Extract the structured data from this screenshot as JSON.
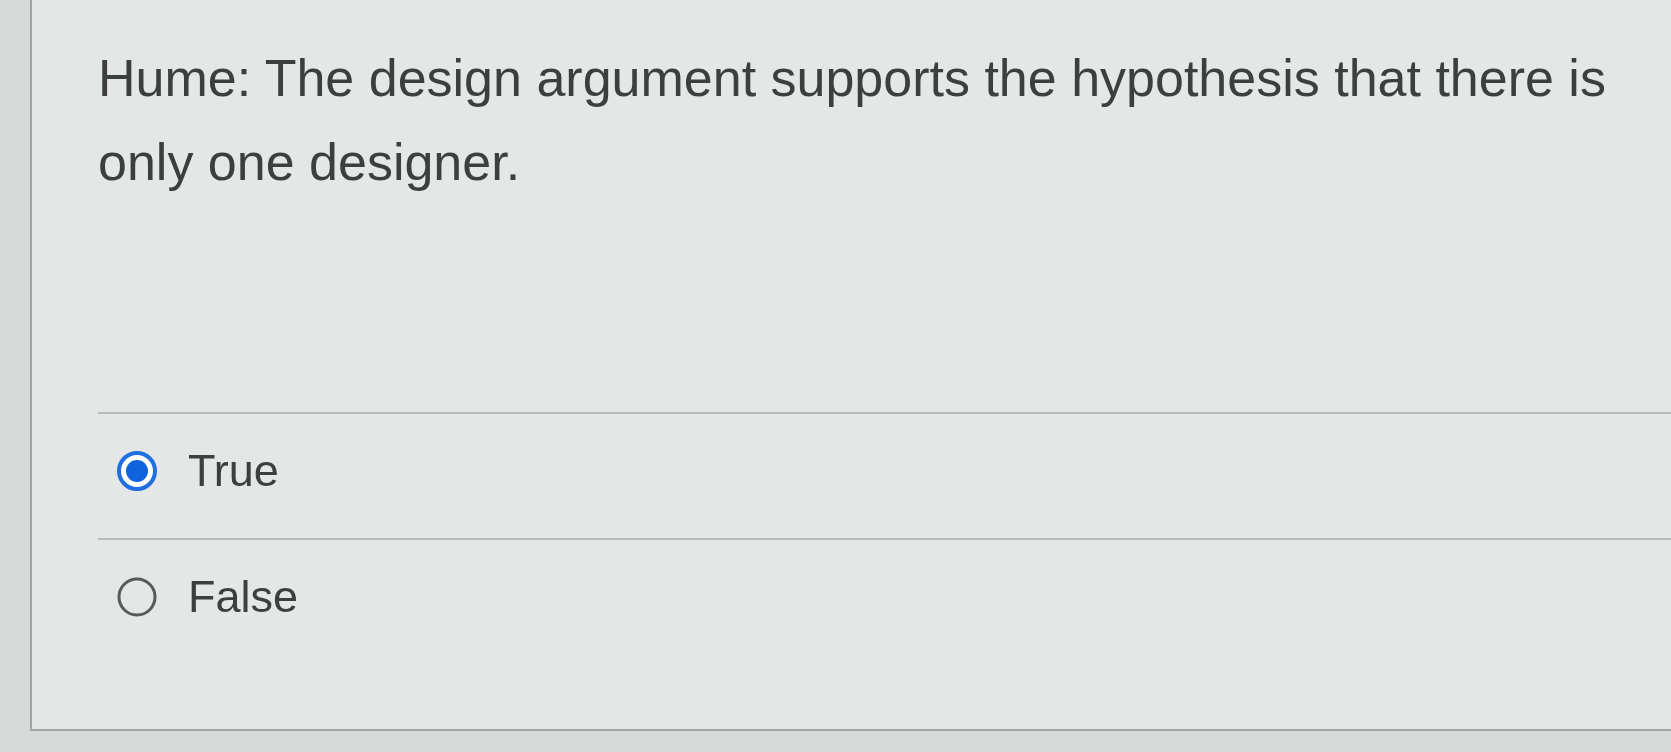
{
  "question": {
    "text": "Hume: The design argument supports the hypothesis that there is only one designer."
  },
  "options": [
    {
      "label": "True",
      "selected": true
    },
    {
      "label": "False",
      "selected": false
    }
  ]
}
